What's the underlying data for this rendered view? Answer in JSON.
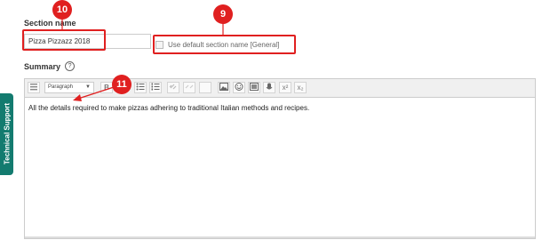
{
  "side_tab": {
    "label": "Technical Support"
  },
  "section": {
    "label": "Section name",
    "value": "Pizza Pizzazz 2018",
    "default_label": "Use default section name [General]"
  },
  "summary": {
    "label": "Summary",
    "help_glyph": "?",
    "toolbar": {
      "paragraph_select": "Paragraph",
      "bold": "B",
      "superscript": "x²",
      "subscript": "x₂"
    },
    "content": "All the details required to make pizzas adhering to traditional Italian methods and recipes."
  },
  "annotations": {
    "badge_10": "10",
    "badge_9": "9",
    "badge_11": "11",
    "color": "#e02020"
  },
  "colors": {
    "side_tab": "#137b6f"
  }
}
